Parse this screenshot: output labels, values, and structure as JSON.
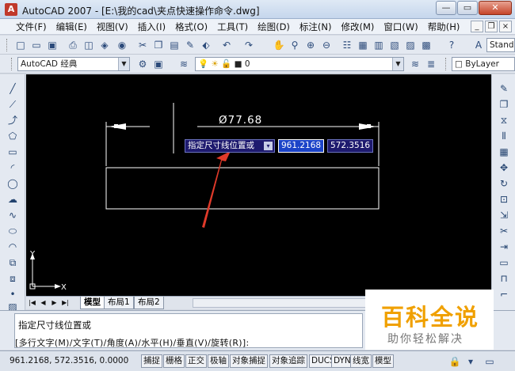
{
  "window": {
    "title": "AutoCAD 2007 - [E:\\我的cad\\夹点快速操作命令.dwg]",
    "minimize": "—",
    "maximize": "▭",
    "close": "✕"
  },
  "menu": {
    "items": [
      "文件(F)",
      "编辑(E)",
      "视图(V)",
      "插入(I)",
      "格式(O)",
      "工具(T)",
      "绘图(D)",
      "标注(N)",
      "修改(M)",
      "窗口(W)",
      "帮助(H)"
    ],
    "doc_min": "_",
    "doc_restore": "❐",
    "doc_close": "×"
  },
  "toolbar1": {
    "text_style": "Stand"
  },
  "toolbar2": {
    "workspace": "AutoCAD 经典",
    "layer": "0",
    "color": "ByLayer"
  },
  "canvas": {
    "dimension_text": "Ø77.68",
    "prompt": "指定尺寸线位置或",
    "x_value": "961.2168",
    "y_value": "572.3516",
    "ucs_x": "X",
    "ucs_y": "Y"
  },
  "tabs": {
    "items": [
      "模型",
      "布局1",
      "布局2"
    ]
  },
  "command": {
    "line1": "指定尺寸线位置或",
    "line2": "[多行文字(M)/文字(T)/角度(A)/水平(H)/垂直(V)/旋转(R)]:"
  },
  "status": {
    "coords": "961.2168,   572.3516,  0.0000",
    "toggles": [
      "捕捉",
      "栅格",
      "正交",
      "极轴",
      "对象捕捉",
      "对象追踪",
      "DUCS",
      "DYN",
      "线宽",
      "模型"
    ]
  },
  "watermark": {
    "title": "百科全说",
    "subtitle": "助你轻松解决"
  },
  "colors": {
    "canvas_bg": "#000000",
    "arrow": "#e03a2a",
    "watermark_title": "#f0a000"
  }
}
